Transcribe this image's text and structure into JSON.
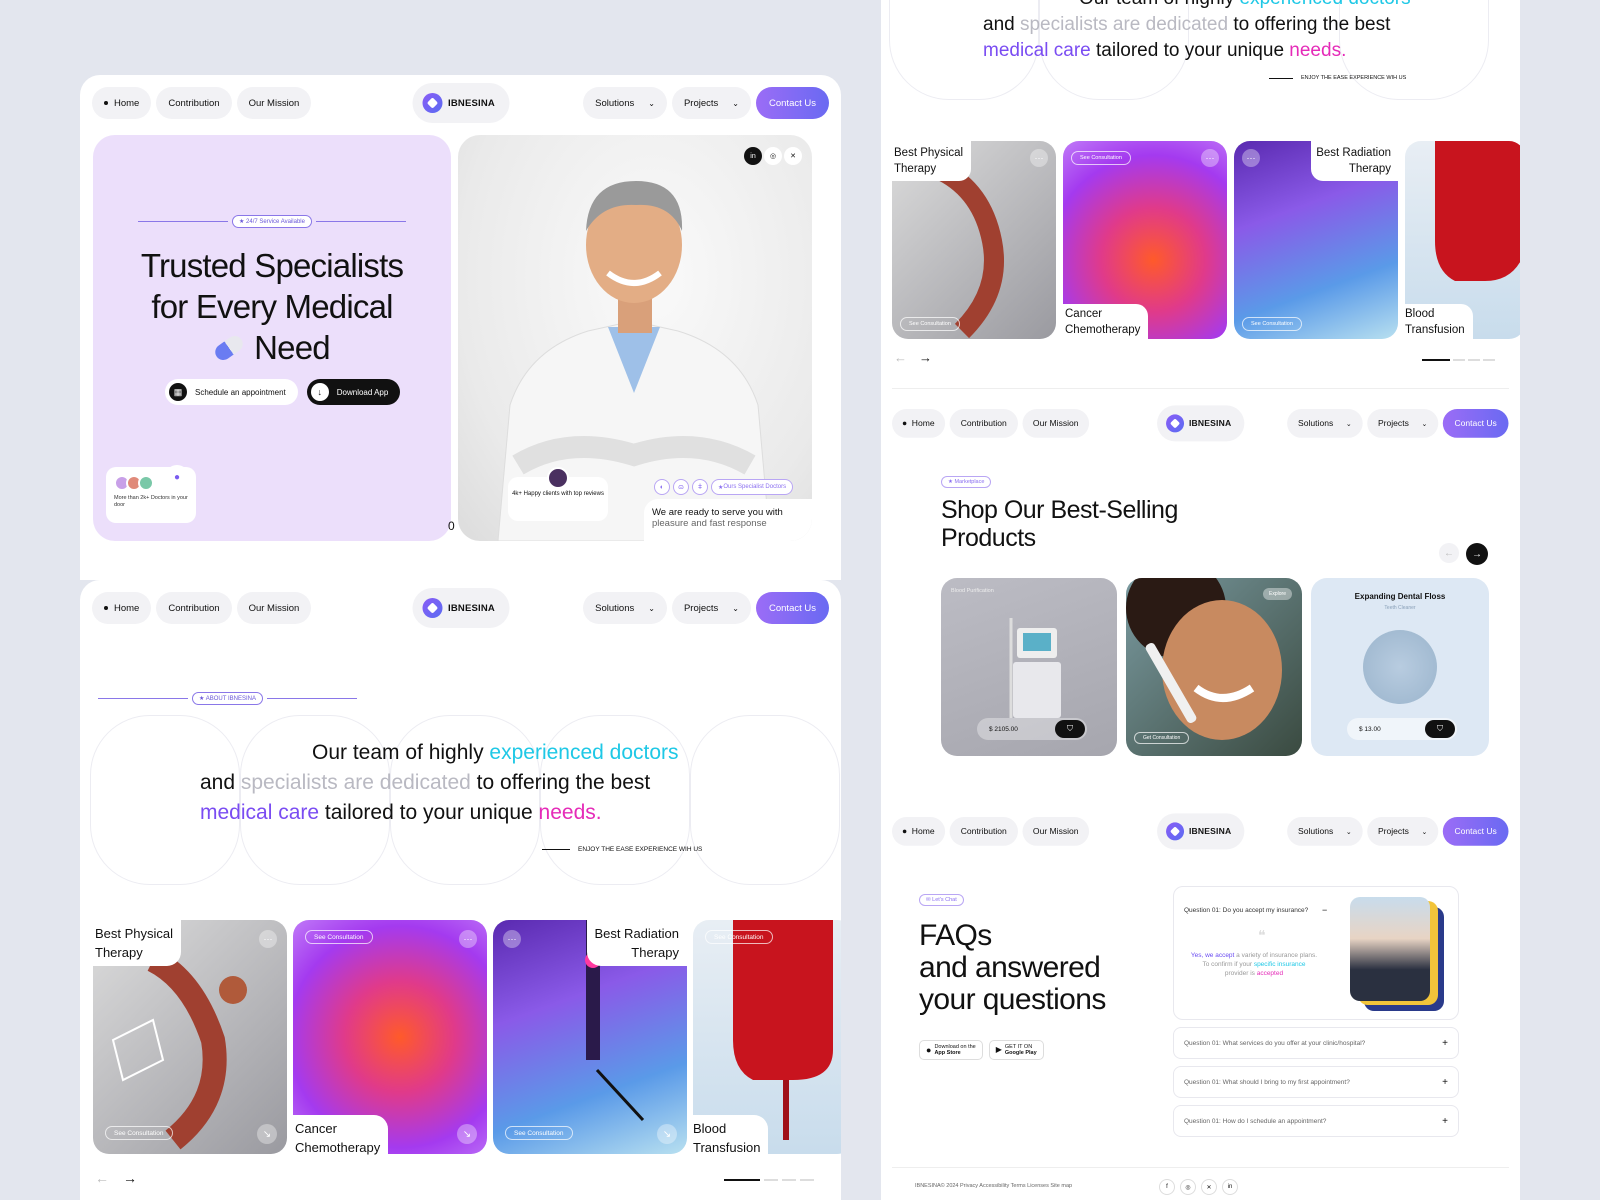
{
  "nav": {
    "home": "Home",
    "contribution": "Contribution",
    "mission": "Our Mission",
    "brand": "IBNESINA",
    "solutions": "Solutions",
    "projects": "Projects",
    "contact": "Contact Us"
  },
  "hero": {
    "badge": "24/7 Service Available",
    "title_line1": "Trusted Specialists",
    "title_line2": "for Every Medical",
    "title_line3": "Need",
    "schedule": "Schedule an appointment",
    "download": "Download App",
    "doctors_count": "More than 2k+ Doctors in your door",
    "happy_clients": "4k+ Happy clients with top reviews",
    "specialist_badge": "Ours Specialist Doctors",
    "ready_text": "We are ready to serve you with",
    "ready_text2": "pleasure and fast response",
    "scroll_indicator": "0",
    "socials": [
      "in",
      "◎",
      "✕"
    ]
  },
  "about": {
    "badge": "ABOUT IBNESINA",
    "line1_a": "Our team of highly ",
    "line1_b": "experienced doctors",
    "line2_a": "and ",
    "line2_b": "specialists are dedicated",
    "line2_c": " to offering the best",
    "line3_a": "medical care",
    "line3_b": " tailored to your unique ",
    "line3_c": "needs.",
    "enjoy": "ENJOY THE EASE EXPERIENCE WIH US"
  },
  "services": [
    {
      "title1": "Best Physical",
      "title2": "Therapy",
      "consult": "See Consultation"
    },
    {
      "title1": "Cancer",
      "title2": "Chemotherapy",
      "consult": "See Consultation"
    },
    {
      "title1": "Best Radiation",
      "title2": "Therapy",
      "consult": "See Consultation"
    },
    {
      "title1": "Blood",
      "title2": "Transfusion",
      "consult": "See Consultation"
    }
  ],
  "shop": {
    "badge": "Marketplace",
    "title1": "Shop Our Best-Selling",
    "title2": "Products",
    "p1_label": "Blood Purification",
    "p1_price": "$ 2105.00",
    "p2_label": "Explore",
    "p2_consult": "Get Consultation",
    "p3_title": "Expanding Dental Floss",
    "p3_sub": "Teeth Cleaner",
    "p3_price": "$ 13.00"
  },
  "faq": {
    "badge": "Let's Chat",
    "title1": "FAQs",
    "title2": "and answered",
    "title3": "your questions",
    "appstore_small": "Download on the",
    "appstore": "App Store",
    "gplay_small": "GET IT ON",
    "gplay": "Google Play",
    "q1": "Question 01: Do you accept my insurance?",
    "a1_a": "Yes, we accept",
    "a1_b": " a variety of insurance plans.",
    "a1_c": "To confirm if your ",
    "a1_d": "specific insurance",
    "a1_e": "provider is ",
    "a1_f": "accepted",
    "q2": "Question 01: What services do you offer at your clinic/hospital?",
    "q3": "Question 01: What should I bring to my first appointment?",
    "q4": "Question 01: How do I schedule an appointment?",
    "footer": "IBNESINA© 2024 Privacy  Accessibility  Terms  Licenses  Site map"
  },
  "colors": {
    "accent": "#8a5cf6",
    "cyan": "#1ec8e6",
    "pink": "#e52bb8",
    "lavender": "#ecdffb"
  }
}
